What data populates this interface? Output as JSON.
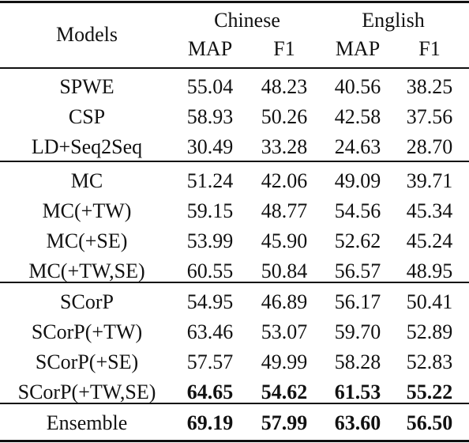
{
  "table": {
    "header": {
      "models_label": "Models",
      "groups": [
        {
          "label": "Chinese",
          "metrics": [
            "MAP",
            "F1"
          ]
        },
        {
          "label": "English",
          "metrics": [
            "MAP",
            "F1"
          ]
        }
      ]
    },
    "sections": [
      {
        "rows": [
          {
            "model": "SPWE",
            "values": [
              "55.04",
              "48.23",
              "40.56",
              "38.25"
            ],
            "bold": false
          },
          {
            "model": "CSP",
            "values": [
              "58.93",
              "50.26",
              "42.58",
              "37.56"
            ],
            "bold": false
          },
          {
            "model": "LD+Seq2Seq",
            "values": [
              "30.49",
              "33.28",
              "24.63",
              "28.70"
            ],
            "bold": false
          }
        ]
      },
      {
        "rows": [
          {
            "model": "MC",
            "values": [
              "51.24",
              "42.06",
              "49.09",
              "39.71"
            ],
            "bold": false
          },
          {
            "model": "MC(+TW)",
            "values": [
              "59.15",
              "48.77",
              "54.56",
              "45.34"
            ],
            "bold": false
          },
          {
            "model": "MC(+SE)",
            "values": [
              "53.99",
              "45.90",
              "52.62",
              "45.24"
            ],
            "bold": false
          },
          {
            "model": "MC(+TW,SE)",
            "values": [
              "60.55",
              "50.84",
              "56.57",
              "48.95"
            ],
            "bold": false
          }
        ]
      },
      {
        "rows": [
          {
            "model": "SCorP",
            "values": [
              "54.95",
              "46.89",
              "56.17",
              "50.41"
            ],
            "bold": false
          },
          {
            "model": "SCorP(+TW)",
            "values": [
              "63.46",
              "53.07",
              "59.70",
              "52.89"
            ],
            "bold": false
          },
          {
            "model": "SCorP(+SE)",
            "values": [
              "57.57",
              "49.99",
              "58.28",
              "52.83"
            ],
            "bold": false
          },
          {
            "model": "SCorP(+TW,SE)",
            "values": [
              "64.65",
              "54.62",
              "61.53",
              "55.22"
            ],
            "bold": true
          }
        ]
      },
      {
        "rows": [
          {
            "model": "Ensemble",
            "values": [
              "69.19",
              "57.99",
              "63.60",
              "56.50"
            ],
            "bold": true
          }
        ]
      }
    ]
  }
}
